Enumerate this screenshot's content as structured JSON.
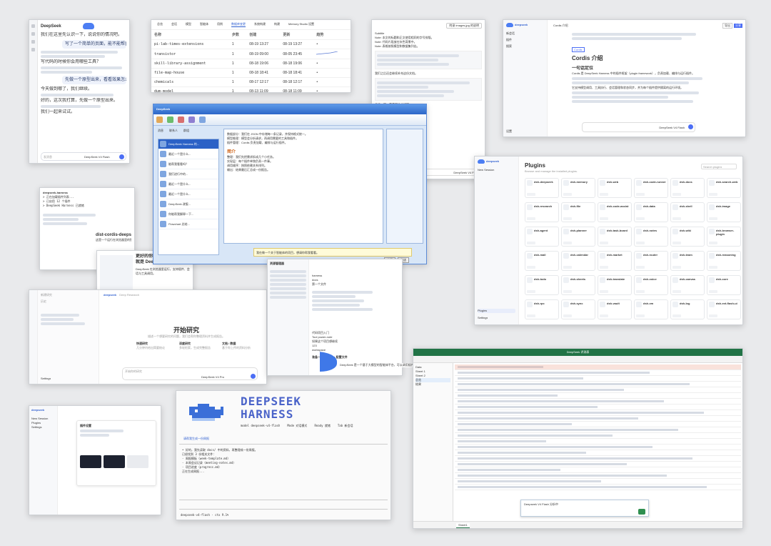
{
  "chat": {
    "brand": "DeepSeek",
    "messages": [
      "我们在这里先认识一下，说说你的情况吧。",
      "写代码的时候你会用哪些工具？",
      "今天做到哪了，我们继续。",
      "好的，这次我打算，先做一个原型出来。",
      "我们一起来试试。"
    ],
    "user_msg": "写了一个简单的页面，能不能帮我看看？",
    "user_msg2": "先做一个原型出来，看看效果怎么样。",
    "input_placeholder": "发消息",
    "model_label": "DeepSeek V4 Flash"
  },
  "table": {
    "tabs": [
      "总览",
      "会话",
      "模型",
      "智能体",
      "用例",
      "数据库变更",
      "系统构建",
      "构建",
      "Memory Studio 设置"
    ],
    "active_tab": 5,
    "headers": [
      "名称",
      "步数",
      "创建",
      "更新",
      "趋势"
    ],
    "rows": [
      [
        "pi-lab-times-extensions",
        "1",
        "08-19 13:27",
        "08-19 13:27",
        ""
      ],
      [
        "transistor",
        "1",
        "08-19 09:00",
        "08-05 23:45",
        ""
      ],
      [
        "skill-library-assignment",
        "1",
        "08-18 19:06",
        "08-18 19:06",
        ""
      ],
      [
        "file-map-house",
        "1",
        "08-18 18:41",
        "08-18 18:41",
        ""
      ],
      [
        "chemicals",
        "1",
        "08-17 12:17",
        "08-18 12:17",
        ""
      ],
      [
        "dum-model",
        "1",
        "08-13 11:09",
        "08-18 11:09",
        ""
      ]
    ]
  },
  "doc": {
    "heading": "附录 images.jpg 的说明",
    "lines": [
      "Subtitle",
      "Note: 本文的标题和正文使用相同的字号排版。",
      "Note: 代码片段放在灰色背景中。",
      "Note: 表格按照模型和数据集列出。"
    ],
    "para": "我们之后还会继续补充这份文档。",
    "section": "总结一下，最重要的点如下：",
    "bullets": [
      "步骤 1：确定目标",
      "步骤 2：整理材料",
      "步骤 3：实现原型",
      "步骤 4：评估结果"
    ],
    "input": "DeepSeek V4 Flash"
  },
  "cordis": {
    "brand": "deepseek",
    "tab": "Cordis 介绍",
    "title": "Cordis 介绍",
    "subtitle": "一句话定位",
    "body": "Cordis 是 DeepSeek Harness 中的插件框架（plugin framework），负责加载、编排与运行插件。",
    "body2": "它支持模型调用、工具执行、会话管理和状态同步，并为每个插件提供隔离的运行环境。",
    "sidebar": [
      "新会话",
      "插件",
      "搜索",
      "设置"
    ],
    "tag": "Cordis",
    "input": "DeepSeek V4 Flash",
    "buttons": [
      "导出",
      "分享"
    ]
  },
  "im": {
    "title": "DeepSeek",
    "tabs": [
      "消息",
      "联系人",
      "群组"
    ],
    "contacts": [
      "DeepSeek Harness 的...",
      "最近一个是什么...",
      "能帮我看看吗？",
      "我们进行中的...",
      "最近一个是什么...",
      "最近一个是什么...",
      "DeepSeek 改版...",
      "你能帮我解释一下...",
      "Flowchart 总结..."
    ],
    "bullets": [
      "数据部分：我们在 JSON 中存储每一条记录，并保持格式统一。",
      "模型推理：模型会分析请求，再调用需要的工具和插件。",
      "插件管理：Cordis 负责加载、编排与运行插件。"
    ],
    "heading": "简介",
    "items": [
      "整理：我们先把需求拆成几个小任务。",
      "实现层：每个插件单独负责一件事。",
      "调用顺序：按照依赖关系排列。",
      "输出：结果最后汇总成一份报告。"
    ],
    "input": "我在做一个关于智能体的项目，想请你帮我看看。",
    "send": "发送",
    "close": "关闭"
  },
  "terminal_small": {
    "title": "deepseek-harness",
    "lines": [
      "> 正在加载插件列表...",
      "> 已启用 12 个插件",
      "> DeepSeek Harness 已就绪"
    ],
    "heading": "dist-cordis-deepseek 插件介绍",
    "text": "这是一个运行在浏览器里的智能体框架。"
  },
  "promo": {
    "title1": "更好的你的伙伴",
    "title2": "就是 DeepSeek Harness Web",
    "text": "DeepSeek 在浏览器里运行，支持插件、会话与工具调用。"
  },
  "research": {
    "brand": "deepseek",
    "crumb": "Deep Research",
    "title": "开始研究",
    "subtitle": "描述一个想要研究的问题，我们会帮你整理资料并生成报告。",
    "cards": [
      {
        "title": "快速研究",
        "desc": "几分钟内给出简要结论"
      },
      {
        "title": "深度研究",
        "desc": "多轮检索，生成完整报告"
      },
      {
        "title": "文档 / 数据",
        "desc": "基于你上传的资料分析"
      }
    ],
    "input": "开始你的研究",
    "model": "DeepSeek V4 Pro",
    "settings": "Settings",
    "sidebar": [
      "新建研究",
      "历史"
    ]
  },
  "plugins": {
    "brand": "deepseek",
    "title": "Plugins",
    "subtitle": "Browse and manage the installed plugins.",
    "search": "Search plugins",
    "sidebar": [
      "New Session",
      "Plugins",
      "Settings"
    ],
    "cards": [
      "dsh-deepseek",
      "dsh-memory",
      "dsh-web",
      "dsh-code-runner",
      "dsh-docs",
      "dsh-search-web",
      "dsh-research",
      "dsh-file",
      "dsh-code-assist",
      "dsh-data",
      "dsh-shell",
      "dsh-image",
      "dsh-agent",
      "dsh-planner",
      "dsh-task-board",
      "dsh-notes",
      "dsh-wiki",
      "dsh-browser-plugin",
      "dsh-mail",
      "dsh-calendar",
      "dsh-market",
      "dsh-router",
      "dsh-team",
      "dsh-reasoning",
      "dsh-todo",
      "dsh-sheets",
      "dsh-translate",
      "dsh-voice",
      "dsh-canvas",
      "dsh-core",
      "dsh-rpc",
      "dsh-sync",
      "dsh-vault",
      "dsh-vm",
      "dsh-log",
      "dsh-ext-flash-ui"
    ],
    "tag": "Install",
    "active": "Plugins"
  },
  "files": {
    "title": "资源管理器",
    "items": [
      "harness",
      "docs",
      "第一个文件",
      "代码项目入门",
      "Tool power-note",
      "如果这个项目想继续",
      "123",
      "workspace"
    ],
    "heading": "准备一个 harness 配置文件"
  },
  "terminal": {
    "logo": "DEEPSEEK HARNESS",
    "meta": [
      "model deepseek-v4-flash",
      "Mode 对话模式",
      "Ready 就绪",
      "Tab 新会话"
    ],
    "prompt": "请帮我生成一份周报",
    "lines": [
      "• 好的，我先读取 docs/ 中的资料，再整理成一份周报。",
      "  已经找到 3 份相关文件：",
      "  - 周报模板（week-template.md）",
      "  - 本周会议记录（meeting-notes.md）",
      "  - 项目进度（progress.md）",
      "  正在生成周报..."
    ],
    "status": "deepseek-v4-flash · ctx 9.1%"
  },
  "sheet": {
    "title": "DeepSeek 评测表",
    "sidebar": [
      "Data",
      "Sheet 1",
      "Sheet 2",
      "总览",
      "结果"
    ],
    "rows": 22,
    "footer": "Sheet1",
    "dialog": "Deepseek V4 Flash 分析中"
  },
  "bottom_left": {
    "brand": "deepseek",
    "title": "插件设置",
    "items": [
      "New Session",
      "Plugins",
      "Settings"
    ]
  },
  "whale_card": {
    "text": "DeepSeek 是一个基于大模型的智能体平台，可以调用插件。"
  }
}
